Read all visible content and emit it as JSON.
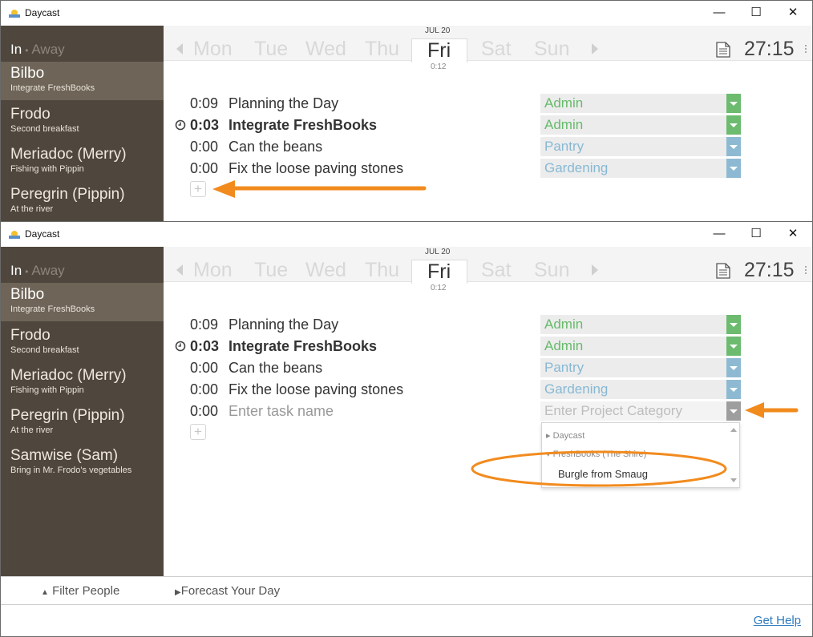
{
  "app_title": "Daycast",
  "window_controls": {
    "minimize": "—",
    "maximize": "☐",
    "close": "✕"
  },
  "status": {
    "in": "In",
    "separator": "•",
    "away": "Away"
  },
  "people_top": [
    {
      "name": "Bilbo",
      "task": "Integrate FreshBooks"
    },
    {
      "name": "Frodo",
      "task": "Second breakfast"
    },
    {
      "name": "Meriadoc (Merry)",
      "task": "Fishing with Pippin"
    },
    {
      "name": "Peregrin (Pippin)",
      "task": "At the river"
    }
  ],
  "people_bottom": [
    {
      "name": "Bilbo",
      "task": "Integrate FreshBooks"
    },
    {
      "name": "Frodo",
      "task": "Second breakfast"
    },
    {
      "name": "Meriadoc (Merry)",
      "task": "Fishing with Pippin"
    },
    {
      "name": "Peregrin (Pippin)",
      "task": "At the river"
    },
    {
      "name": "Samwise (Sam)",
      "task": "Bring in Mr. Frodo's vegetables"
    }
  ],
  "daybar": {
    "days": [
      "Mon",
      "Tue",
      "Wed",
      "Thu",
      "Fri",
      "Sat",
      "Sun"
    ],
    "selected_date": "JUL 20",
    "selected_day_time": "0:12",
    "total_time": "27:15"
  },
  "tasks": [
    {
      "time": "0:09",
      "name": "Planning the Day",
      "category": "Admin",
      "color": "green"
    },
    {
      "time": "0:03",
      "name": "Integrate FreshBooks",
      "category": "Admin",
      "color": "green",
      "active": true
    },
    {
      "time": "0:00",
      "name": "Can the beans",
      "category": "Pantry",
      "color": "blue"
    },
    {
      "time": "0:00",
      "name": "Fix the loose paving stones",
      "category": "Gardening",
      "color": "blue"
    }
  ],
  "new_task": {
    "time": "0:00",
    "name_placeholder": "Enter task name",
    "category_placeholder": "Enter Project Category"
  },
  "add_button": "+",
  "dropdown": {
    "groups": [
      "Daycast",
      "FreshBooks (The Shire)"
    ],
    "options": [
      "Burgle from Smaug"
    ]
  },
  "footer": {
    "filter_people": "Filter People",
    "forecast_day": "Forecast Your Day",
    "help": "Get Help"
  },
  "colors": {
    "sidebar_bg": "#4f473d",
    "sidebar_selected": "#6e6457",
    "category_green": "#6cbb6f",
    "category_blue": "#8dbad2",
    "annotation_orange": "#f28b1e",
    "link_blue": "#2e7bbf"
  }
}
